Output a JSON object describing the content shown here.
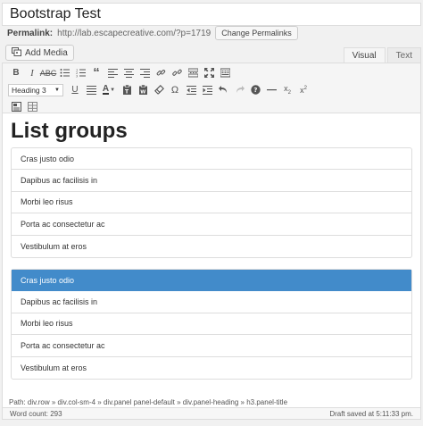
{
  "post": {
    "title": "Bootstrap Test"
  },
  "permalink": {
    "label": "Permalink:",
    "url": "http://lab.escapecreative.com/?p=1719",
    "change_button": "Change Permalinks"
  },
  "media": {
    "add_label": "Add Media"
  },
  "tabs": {
    "visual": "Visual",
    "text": "Text"
  },
  "toolbar": {
    "format_value": "Heading 3"
  },
  "content": {
    "heading": "List groups",
    "group1": [
      "Cras justo odio",
      "Dapibus ac facilisis in",
      "Morbi leo risus",
      "Porta ac consectetur ac",
      "Vestibulum at eros"
    ],
    "group2": [
      "Cras justo odio",
      "Dapibus ac facilisis in",
      "Morbi leo risus",
      "Porta ac consectetur ac",
      "Vestibulum at eros"
    ]
  },
  "path": "Path: div.row » div.col-sm-4 » div.panel panel-default » div.panel-heading » h3.panel-title",
  "status": {
    "word_count": "Word count: 293",
    "draft_saved": "Draft saved at 5:11:33 pm."
  },
  "colors": {
    "active_item": "#428bca"
  }
}
